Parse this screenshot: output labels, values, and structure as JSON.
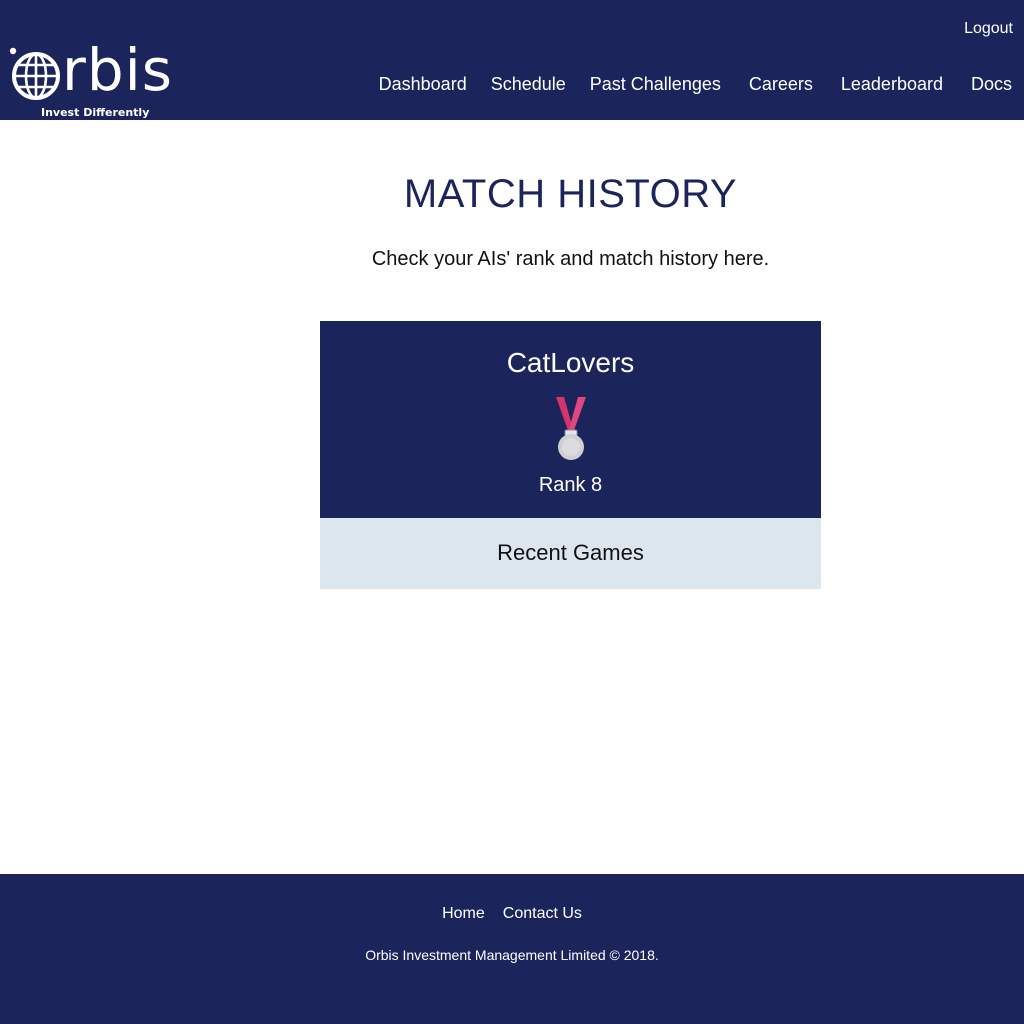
{
  "header": {
    "logo": {
      "word": "rbis",
      "tagline": "Invest Differently"
    },
    "logout_label": "Logout",
    "nav": [
      {
        "label": "Dashboard"
      },
      {
        "label": "Schedule"
      },
      {
        "label": "Past Challenges"
      },
      {
        "label": "Careers"
      },
      {
        "label": "Leaderboard"
      },
      {
        "label": "Docs"
      }
    ]
  },
  "main": {
    "title": "MATCH HISTORY",
    "subtitle": "Check your AIs' rank and match history here.",
    "ai_card": {
      "name": "CatLovers",
      "medal_icon": "silver-medal-icon",
      "rank_label": "Rank 8"
    },
    "recent_games": {
      "title": "Recent Games"
    }
  },
  "footer": {
    "links": [
      {
        "label": "Home"
      },
      {
        "label": "Contact Us"
      }
    ],
    "copyright": "Orbis Investment Management Limited © 2018."
  },
  "colors": {
    "navy": "#1b255c",
    "light_panel": "#dce6ef",
    "ribbon": "#d6336c",
    "medal_silver": "#cfcfd4"
  }
}
